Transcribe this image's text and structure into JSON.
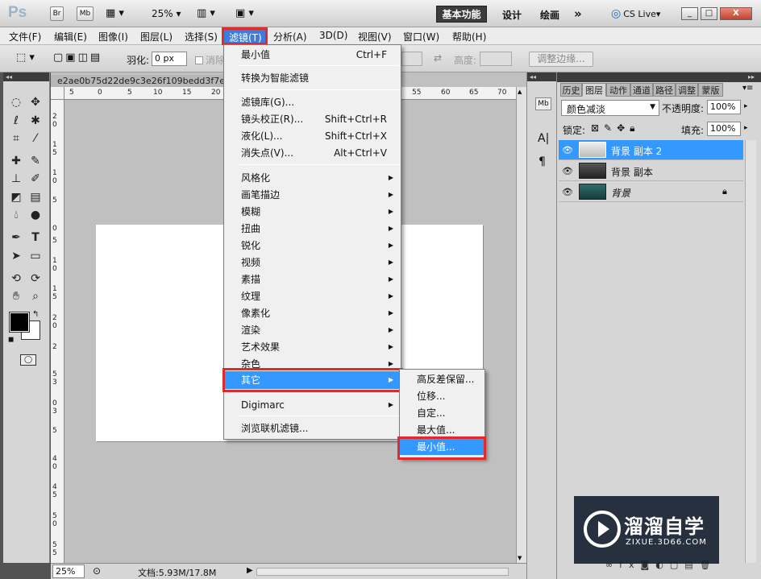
{
  "appbar": {
    "logo": "Ps",
    "btn_br": "Br",
    "btn_mb": "Mb",
    "zoom": "25%",
    "workspaces": {
      "active": "基本功能",
      "design": "设计",
      "paint": "绘画",
      "more": "»"
    },
    "cslive": "CS Live",
    "window_controls": [
      "_",
      "□",
      "X"
    ]
  },
  "menubar": [
    "文件(F)",
    "编辑(E)",
    "图像(I)",
    "图层(L)",
    "选择(S)",
    "滤镜(T)",
    "分析(A)",
    "3D(D)",
    "视图(V)",
    "窗口(W)",
    "帮助(H)"
  ],
  "options": {
    "feather_label": "羽化:",
    "feather_value": "0 px",
    "antialias_label": "消除",
    "height_label": "高度:",
    "refine_edge": "调整边缘..."
  },
  "document": {
    "tab_title": "e2ae0b75d22de9c3e26f109bedd3f7e",
    "status_zoom": "25%",
    "doc_info": "文档:5.93M/17.8M"
  },
  "ruler_h": [
    "5",
    "0",
    "5",
    "10",
    "15",
    "20",
    "55",
    "60",
    "65",
    "70"
  ],
  "ruler_v": [
    "2",
    "0",
    "1",
    "5",
    "1",
    "0",
    "5",
    "0",
    "5",
    "1",
    "0",
    "1",
    "5",
    "2",
    "0",
    "2",
    "5",
    "3",
    "0",
    "3",
    "5",
    "4",
    "0",
    "4",
    "5",
    "5",
    "0",
    "5",
    "5"
  ],
  "filter_menu": {
    "last_filter": {
      "label": "最小值",
      "shortcut": "Ctrl+F"
    },
    "smart": "转换为智能滤镜",
    "group2": [
      {
        "label": "滤镜库(G)...",
        "shortcut": ""
      },
      {
        "label": "镜头校正(R)...",
        "shortcut": "Shift+Ctrl+R"
      },
      {
        "label": "液化(L)...",
        "shortcut": "Shift+Ctrl+X"
      },
      {
        "label": "消失点(V)...",
        "shortcut": "Alt+Ctrl+V"
      }
    ],
    "submenus": [
      "风格化",
      "画笔描边",
      "模糊",
      "扭曲",
      "锐化",
      "视频",
      "素描",
      "纹理",
      "像素化",
      "渲染",
      "艺术效果",
      "杂色"
    ],
    "other": "其它",
    "digimarc": "Digimarc",
    "browse": "浏览联机滤镜..."
  },
  "other_submenu": [
    "高反差保留...",
    "位移...",
    "自定...",
    "最大值...",
    "最小值..."
  ],
  "layers_panel": {
    "tabs": [
      "历史",
      "图层",
      "动作",
      "通道",
      "路径",
      "调整",
      "蒙版"
    ],
    "blend_mode": "颜色减淡",
    "opacity_label": "不透明度:",
    "opacity": "100%",
    "lock_label": "锁定:",
    "fill_label": "填充:",
    "fill": "100%",
    "layers": [
      {
        "name": "背景 副本 2",
        "selected": true
      },
      {
        "name": "背景 副本",
        "selected": false
      },
      {
        "name": "背景",
        "selected": false
      }
    ]
  },
  "panel_strip": [
    "Mb",
    "A|",
    "¶"
  ],
  "watermark": {
    "title": "溜溜自学",
    "url": "ZIXUE.3D66.COM"
  },
  "colors": {
    "highlight": "#3399ff",
    "red_box": "#e12b2b",
    "menu_selected": "#3d7ddc"
  }
}
